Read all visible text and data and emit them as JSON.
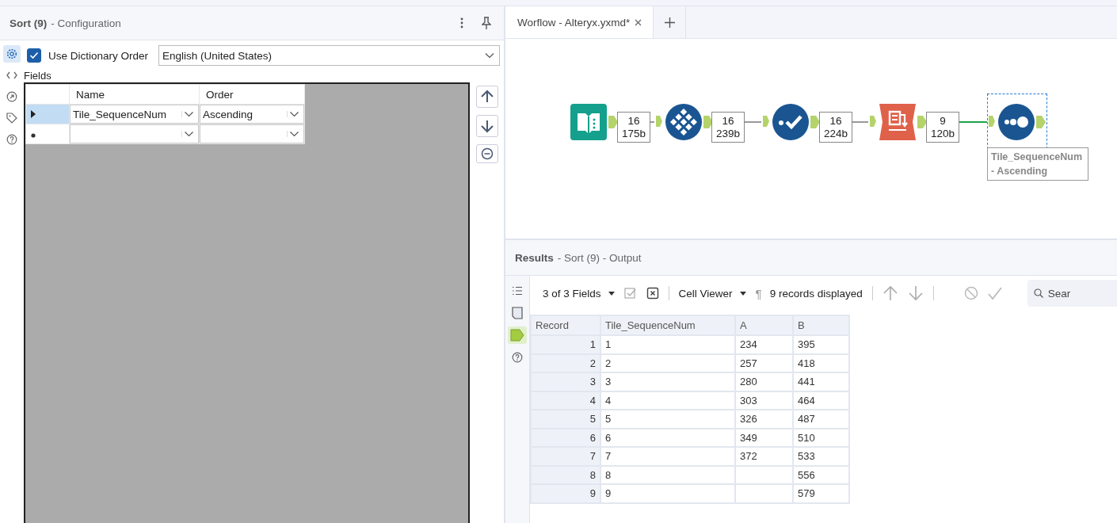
{
  "config_panel": {
    "title": "Sort (9)",
    "subtitle": "- Configuration",
    "side_tabs": [
      {
        "kind": "gear",
        "selected": true
      },
      {
        "kind": "code",
        "selected": false
      },
      {
        "kind": "annotation",
        "selected": false
      },
      {
        "kind": "tag",
        "selected": false
      },
      {
        "kind": "help",
        "selected": false
      }
    ],
    "dictionary_order": {
      "label": "Use Dictionary Order",
      "checked": true,
      "language": "English (United States)"
    },
    "fields_label": "Fields",
    "columns": [
      "Name",
      "Order"
    ],
    "rows": [
      {
        "name": "Tile_SequenceNum",
        "order": "Ascending",
        "selected": true,
        "new": false
      },
      {
        "name": "",
        "order": "",
        "selected": false,
        "new": true
      }
    ]
  },
  "workflow_tabs": [
    {
      "label": "Worflow - Alteryx.yxmd*",
      "selected": true
    }
  ],
  "canvas": {
    "tools": [
      {
        "kind": "input",
        "selected": false,
        "records": "16",
        "size": "175b"
      },
      {
        "kind": "select",
        "selected": false,
        "records": "16",
        "size": "239b"
      },
      {
        "kind": "filter",
        "selected": false,
        "records": "16",
        "size": "224b"
      },
      {
        "kind": "sample",
        "selected": false,
        "records": "9",
        "size": "120b"
      },
      {
        "kind": "sort",
        "selected": true,
        "annotation": "Tile_SequenceNum - Ascending"
      }
    ]
  },
  "results": {
    "title": "Results",
    "subtitle": "- Sort (9) - Output",
    "side_tabs": [
      {
        "kind": "list",
        "selected": false
      },
      {
        "kind": "book",
        "selected": false
      },
      {
        "kind": "tag",
        "selected": true
      },
      {
        "kind": "help",
        "selected": false
      }
    ],
    "fields_menu": "3 of 3 Fields",
    "viewer_menu": "Cell Viewer",
    "pilcrow": "¶",
    "record_count": "9 records displayed",
    "search": {
      "placeholder": "Sear"
    },
    "columns": [
      "Record",
      "Tile_SequenceNum",
      "A",
      "B"
    ],
    "rows": [
      [
        "1",
        "1",
        "234",
        "395"
      ],
      [
        "2",
        "2",
        "257",
        "418"
      ],
      [
        "3",
        "3",
        "280",
        "441"
      ],
      [
        "4",
        "4",
        "303",
        "464"
      ],
      [
        "5",
        "5",
        "326",
        "487"
      ],
      [
        "6",
        "6",
        "349",
        "510"
      ],
      [
        "7",
        "7",
        "372",
        "533"
      ],
      [
        "8",
        "8",
        "",
        "556"
      ],
      [
        "9",
        "9",
        "",
        "579"
      ]
    ]
  }
}
